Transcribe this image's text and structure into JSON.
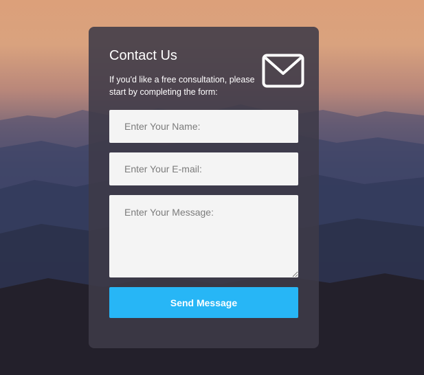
{
  "contact": {
    "title": "Contact Us",
    "subtitle": "If you'd like a free consultation, please start by completing the form:",
    "icon": "envelope-icon",
    "name_placeholder": "Enter Your Name:",
    "email_placeholder": "Enter Your E-mail:",
    "message_placeholder": "Enter Your Message:",
    "send_label": "Send Message"
  },
  "colors": {
    "accent": "#27b6f6",
    "card_background": "#3e3a48",
    "field_background": "#f4f4f4"
  }
}
